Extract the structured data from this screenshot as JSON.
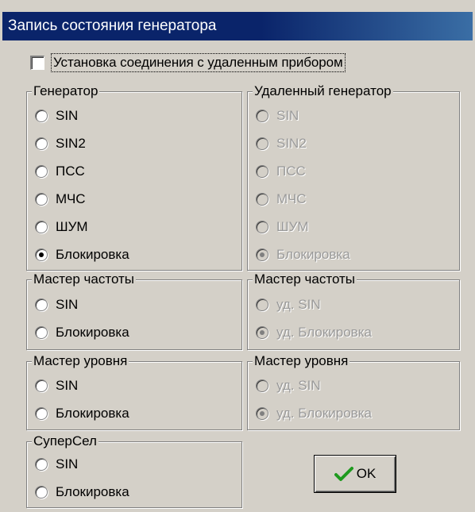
{
  "window": {
    "title": "Запись состояния генератора"
  },
  "connection": {
    "label": "Установка соединения с удаленным прибором",
    "checked": false
  },
  "groups": {
    "generator": {
      "title": "Генератор",
      "options": [
        "SIN",
        "SIN2",
        "ПСС",
        "МЧС",
        "ШУМ",
        "Блокировка"
      ],
      "selected": "Блокировка"
    },
    "remote_generator": {
      "title": "Удаленный генератор",
      "options": [
        "SIN",
        "SIN2",
        "ПСС",
        "МЧС",
        "ШУМ",
        "Блокировка"
      ],
      "selected": "Блокировка"
    },
    "freq_master": {
      "title": "Мастер частоты",
      "options": [
        "SIN",
        "Блокировка"
      ],
      "selected": ""
    },
    "remote_freq_master": {
      "title": "Мастер частоты",
      "options": [
        "уд. SIN",
        "уд. Блокировка"
      ],
      "selected": "уд. Блокировка"
    },
    "level_master": {
      "title": "Мастер уровня",
      "options": [
        "SIN",
        "Блокировка"
      ],
      "selected": ""
    },
    "remote_level_master": {
      "title": "Мастер уровня",
      "options": [
        "уд. SIN",
        "уд. Блокировка"
      ],
      "selected": "уд. Блокировка"
    },
    "supersel": {
      "title": "СуперСел",
      "options": [
        "SIN",
        "Блокировка"
      ],
      "selected": ""
    }
  },
  "ok_button": {
    "label": "OK",
    "icon": "checkmark-icon"
  },
  "colors": {
    "titlebar": "#0a246a",
    "face": "#d4d0c8",
    "disabled_text": "#9a9a9a",
    "check_green": "#1e9a1e"
  }
}
